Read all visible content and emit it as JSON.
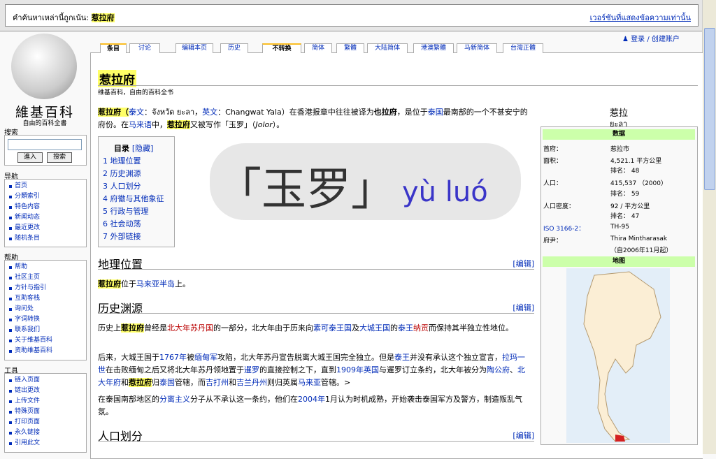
{
  "cache": {
    "label": "คำค้นหาเหล่านี้ถูกเน้น:",
    "term": "惹拉府",
    "text_version_link": "เวอร์ชันที่แสดงข้อความเท่านั้น"
  },
  "logo": {
    "title": "維基百科",
    "subtitle": "自由的百科全書"
  },
  "search": {
    "heading": "搜索",
    "go_button": "進入",
    "search_button": "搜索"
  },
  "sidebar": {
    "nav_heading": "导航",
    "nav_items": [
      "首页",
      "分類索引",
      "特色内容",
      "新闻动态",
      "最近更改",
      "随机条目"
    ],
    "help_heading": "帮助",
    "help_items": [
      "帮助",
      "社区主页",
      "方针与指引",
      "互助客栈",
      "询问处",
      "字词转换",
      "联系我们",
      "关于维基百科",
      "资助维基百科"
    ],
    "tools_heading": "工具",
    "tools_items": [
      "链入页面",
      "链出更改",
      "上传文件",
      "特殊页面",
      "打印页面",
      "永久链接",
      "引用此文"
    ]
  },
  "tabs": [
    "条目",
    "讨论",
    "编辑本页",
    "历史",
    "不转换",
    "简体",
    "繁體",
    "大陆简体",
    "港澳繁體",
    "马新简体",
    "台灣正體"
  ],
  "login": "登录 / 创建账户",
  "article": {
    "title": "惹拉府",
    "subtitle": "维基百科，自由的百科全书",
    "intro_1a": "惹拉府（",
    "intro_1b": "泰文",
    "intro_1c": "：จังหวัด ยะลา，",
    "intro_1d": "英文",
    "intro_1e": "：Changwat Yala）在香港报章中往往被译为",
    "intro_1f": "也拉府",
    "intro_1g": "，是位于",
    "intro_1h": "泰国",
    "intro_1i": "最南部的一个不甚安宁的府份。在",
    "intro_1j": "马来语",
    "intro_1k": "中，",
    "intro_1l": "惹拉府",
    "intro_1m": "又被写作「玉罗」（",
    "intro_1n": "Jolor",
    "intro_1o": "）。"
  },
  "toc": {
    "title": "目录",
    "hide": "[隐藏]",
    "items": [
      "1 地理位置",
      "2 历史渊源",
      "3 人口划分",
      "4 府徽与其他象征",
      "5 行政与管理",
      "6 社会动荡",
      "7 外部链接"
    ]
  },
  "overlay": {
    "chars": "「玉罗」",
    "pinyin": "yù luó"
  },
  "sections": {
    "geo": {
      "title": "地理位置",
      "edit": "[编辑]",
      "p1": "惹拉府",
      "p2": "位于",
      "p3": "马来亚半岛",
      "p4": "上。"
    },
    "history": {
      "title": "历史渊源",
      "edit": "[编辑]",
      "p1a": "历史上",
      "p1b": "惹拉府",
      "p1c": "曾经是",
      "p1d": "北大年苏丹国",
      "p1e": "的一部分，北大年由于历来向",
      "p1f": "素可泰王国",
      "p1g": "及",
      "p1h": "大城王国",
      "p1i": "的",
      "p1j": "泰王",
      "p1k": "纳贡",
      "p1l": "而保持其半独立性地位。",
      "p2a": "后来，大城王国于",
      "p2b": "1767年",
      "p2c": "被",
      "p2d": "缅甸军",
      "p2e": "攻陷，北大年苏丹宣告脱离大城王国完全独立。但是",
      "p2f": "泰王",
      "p2g": "并没有承认这个独立宣言，",
      "p2h": "拉玛一世",
      "p2i": "在击败缅甸之后又将北大年苏丹领地置于",
      "p2j": "暹罗",
      "p2k": "的直接控制之下，直到",
      "p2l": "1909年",
      "p2m": "英国",
      "p2n": "与暹罗订立条约，北大年被分为",
      "p2o": "陶公府",
      "p2p": "、",
      "p2q": "北大年府",
      "p2r": "和",
      "p2s": "惹拉府",
      "p2t": "归",
      "p2u": "泰国",
      "p2v": "管辖，而",
      "p2w": "吉打州",
      "p2x": "和",
      "p2y": "吉兰丹州",
      "p2z": "则归英属",
      "p2aa": "马来亚",
      "p2ab": "管辖。>",
      "p3a": "在泰国南部地区的",
      "p3b": "分离主义",
      "p3c": "分子从不承认这一条约，他们在",
      "p3d": "2004年",
      "p3e": "1月认为时机成熟，开始袭击泰国军方及警方，制造叛乱气氛。"
    },
    "pop": {
      "title": "人口划分",
      "edit": "[编辑]"
    }
  },
  "infobox": {
    "name": "惹拉",
    "name_thai": "ยะลา",
    "data_heading": "数据",
    "rows": [
      {
        "k": "首府：",
        "v": "惹拉市"
      },
      {
        "k": "面积：",
        "v": "4,521.1 平方公里"
      },
      {
        "k": "",
        "v": "排名： 48"
      },
      {
        "k": "人口：",
        "v": "415,537 （2000）"
      },
      {
        "k": "",
        "v": "排名： 59"
      },
      {
        "k": "人口密度：",
        "v": "92 / 平方公里"
      },
      {
        "k": "",
        "v": "排名： 47"
      },
      {
        "k": "ISO 3166-2：",
        "v": "TH-95"
      },
      {
        "k": "府尹：",
        "v": "Thira Mintharasak"
      },
      {
        "k": "",
        "v": "（自2006年11月起）"
      }
    ],
    "map_heading": "地图"
  },
  "colors": {
    "highlight": "#ffff66",
    "link": "#002bb8",
    "redlink": "#ba0000",
    "infobox_head": "#ccffaa"
  }
}
